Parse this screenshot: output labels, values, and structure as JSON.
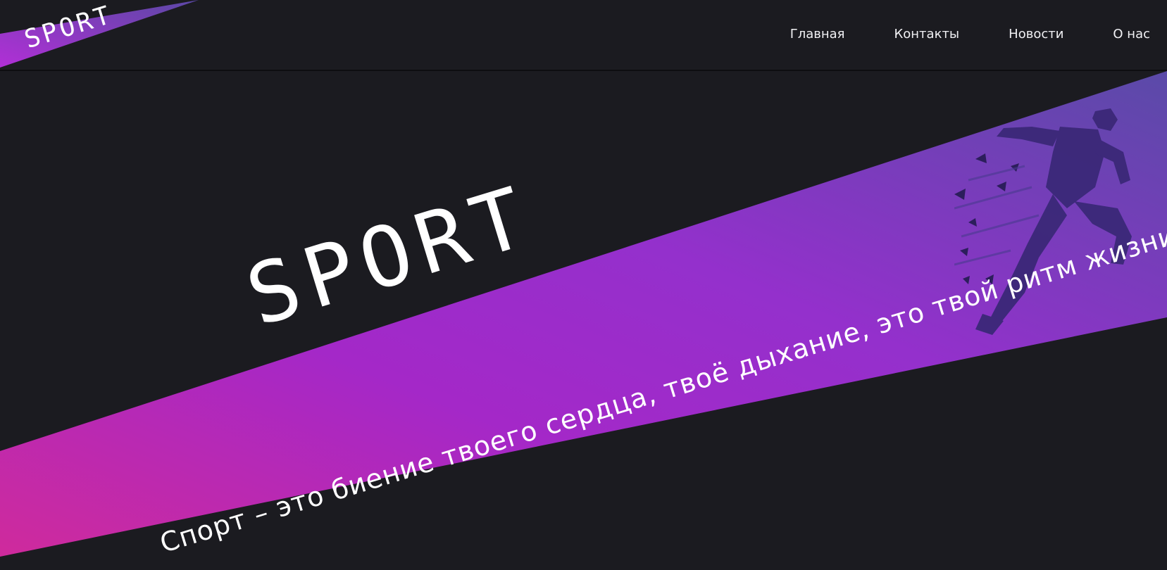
{
  "header": {
    "logo_text": "SPORT",
    "nav": [
      {
        "label": "Главная"
      },
      {
        "label": "Контакты"
      },
      {
        "label": "Новости"
      },
      {
        "label": "О нас"
      }
    ]
  },
  "hero": {
    "title": "SPORT",
    "tagline": "Спорт – это биение твоего сердца, твоё дыхание, это твой ритм жизни.",
    "image": "running-athlete-silhouette"
  },
  "colors": {
    "background": "#1b1b20",
    "gradient_start": "#d12b9f",
    "gradient_mid": "#9b2ad1",
    "gradient_end": "#5a4aa8",
    "text": "#ffffff"
  }
}
